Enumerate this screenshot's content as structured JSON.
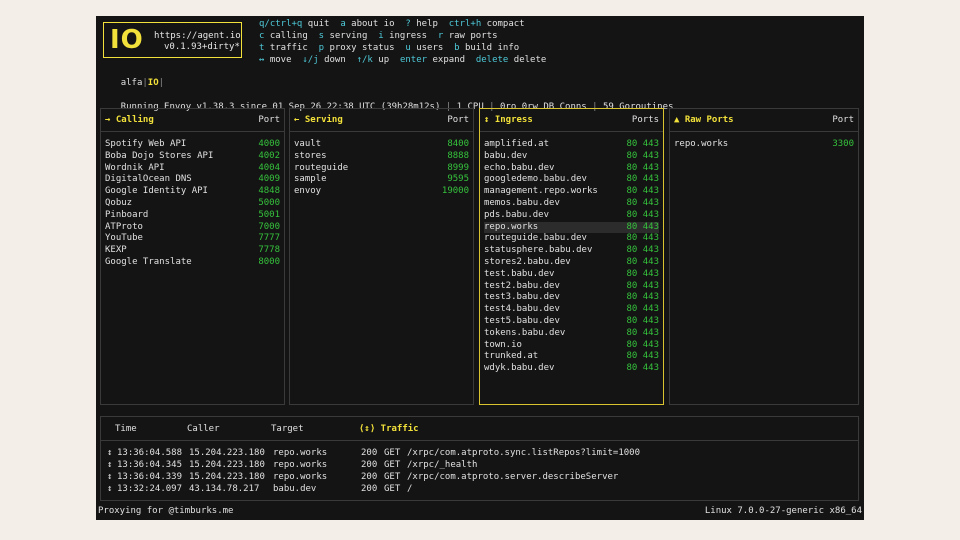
{
  "logo": {
    "mark": "IO",
    "url": "https://agent.io",
    "version": "v0.1.93+dirty*"
  },
  "context": {
    "name": "alfa",
    "sep": "|",
    "badge": "IO",
    "sep2": "|"
  },
  "shortcuts": [
    [
      {
        "k": "q/ctrl+q",
        "d": "quit"
      },
      {
        "k": "a",
        "d": "about io"
      },
      {
        "k": "?",
        "d": "help"
      },
      {
        "k": "ctrl+h",
        "d": "compact"
      }
    ],
    [
      {
        "k": "c",
        "d": "calling"
      },
      {
        "k": "s",
        "d": "serving"
      },
      {
        "k": "i",
        "d": "ingress"
      },
      {
        "k": "r",
        "d": "raw ports"
      }
    ],
    [
      {
        "k": "t",
        "d": "traffic"
      },
      {
        "k": "p",
        "d": "proxy status"
      },
      {
        "k": "u",
        "d": "users"
      },
      {
        "k": "b",
        "d": "build info"
      }
    ],
    [
      {
        "k": "↔",
        "d": "move"
      },
      {
        "k": "↓/j",
        "d": "down"
      },
      {
        "k": "↑/k",
        "d": "up"
      },
      {
        "k": "enter",
        "d": "expand"
      },
      {
        "k": "delete",
        "d": "delete"
      }
    ]
  ],
  "status": {
    "envoy": "Running Envoy v1.38.3 since 01 Sep 26 22:38 UTC (39h28m12s)",
    "cpu": "1 CPU",
    "db": "0ro 0rw DB Conns",
    "goroutines": "59 Goroutines",
    "sep": "|"
  },
  "panels": {
    "calling": {
      "title": "→ Calling",
      "col": "Port",
      "rows": [
        {
          "name": "Spotify Web API",
          "port": "4000"
        },
        {
          "name": "Boba Dojo Stores API",
          "port": "4002"
        },
        {
          "name": "Wordnik API",
          "port": "4004"
        },
        {
          "name": "DigitalOcean DNS",
          "port": "4009"
        },
        {
          "name": "Google Identity API",
          "port": "4848"
        },
        {
          "name": "Qobuz",
          "port": "5000"
        },
        {
          "name": "Pinboard",
          "port": "5001"
        },
        {
          "name": "ATProto",
          "port": "7000"
        },
        {
          "name": "YouTube",
          "port": "7777"
        },
        {
          "name": "KEXP",
          "port": "7778"
        },
        {
          "name": "Google Translate",
          "port": "8000"
        }
      ]
    },
    "serving": {
      "title": "← Serving",
      "col": "Port",
      "rows": [
        {
          "name": "vault",
          "port": "8400"
        },
        {
          "name": "stores",
          "port": "8888"
        },
        {
          "name": "routeguide",
          "port": "8999"
        },
        {
          "name": "sample",
          "port": "9595"
        },
        {
          "name": "envoy",
          "port": "19000"
        }
      ]
    },
    "ingress": {
      "title": "↕ Ingress",
      "col": "Ports",
      "rows": [
        {
          "name": "amplified.at",
          "port": "80 443"
        },
        {
          "name": "babu.dev",
          "port": "80 443"
        },
        {
          "name": "echo.babu.dev",
          "port": "80 443"
        },
        {
          "name": "googledemo.babu.dev",
          "port": "80 443"
        },
        {
          "name": "management.repo.works",
          "port": "80 443"
        },
        {
          "name": "memos.babu.dev",
          "port": "80 443"
        },
        {
          "name": "pds.babu.dev",
          "port": "80 443"
        },
        {
          "name": "repo.works",
          "port": "80 443"
        },
        {
          "name": "routeguide.babu.dev",
          "port": "80 443"
        },
        {
          "name": "statusphere.babu.dev",
          "port": "80 443"
        },
        {
          "name": "stores2.babu.dev",
          "port": "80 443"
        },
        {
          "name": "test.babu.dev",
          "port": "80 443"
        },
        {
          "name": "test2.babu.dev",
          "port": "80 443"
        },
        {
          "name": "test3.babu.dev",
          "port": "80 443"
        },
        {
          "name": "test4.babu.dev",
          "port": "80 443"
        },
        {
          "name": "test5.babu.dev",
          "port": "80 443"
        },
        {
          "name": "tokens.babu.dev",
          "port": "80 443"
        },
        {
          "name": "town.io",
          "port": "80 443"
        },
        {
          "name": "trunked.at",
          "port": "80 443"
        },
        {
          "name": "wdyk.babu.dev",
          "port": "80 443"
        }
      ],
      "selected": 7
    },
    "raw": {
      "title": "▲ Raw Ports",
      "col": "Port",
      "rows": [
        {
          "name": "repo.works",
          "port": "3300"
        }
      ]
    }
  },
  "traffic": {
    "headers": {
      "time": "Time",
      "caller": "Caller",
      "target": "Target",
      "title": "⟨↕⟩ Traffic"
    },
    "rows": [
      {
        "icon": "↕",
        "time": "13:36:04.588",
        "caller": "15.204.223.180",
        "target": "repo.works",
        "status": "200",
        "method": "GET",
        "path": "/xrpc/com.atproto.sync.listRepos?limit=1000"
      },
      {
        "icon": "↕",
        "time": "13:36:04.345",
        "caller": "15.204.223.180",
        "target": "repo.works",
        "status": "200",
        "method": "GET",
        "path": "/xrpc/_health"
      },
      {
        "icon": "↕",
        "time": "13:36:04.339",
        "caller": "15.204.223.180",
        "target": "repo.works",
        "status": "200",
        "method": "GET",
        "path": "/xrpc/com.atproto.server.describeServer"
      },
      {
        "icon": "↕",
        "time": "13:32:24.097",
        "caller": "43.134.78.217",
        "target": "babu.dev",
        "status": "200",
        "method": "GET",
        "path": "/"
      }
    ]
  },
  "footer": {
    "left": "Proxying for @timburks.me",
    "right": "Linux 7.0.0-27-generic x86_64"
  },
  "colors": {
    "accent": "#f2e13a",
    "key": "#4ec9d8",
    "port": "#35c23c",
    "bg": "#141414"
  }
}
